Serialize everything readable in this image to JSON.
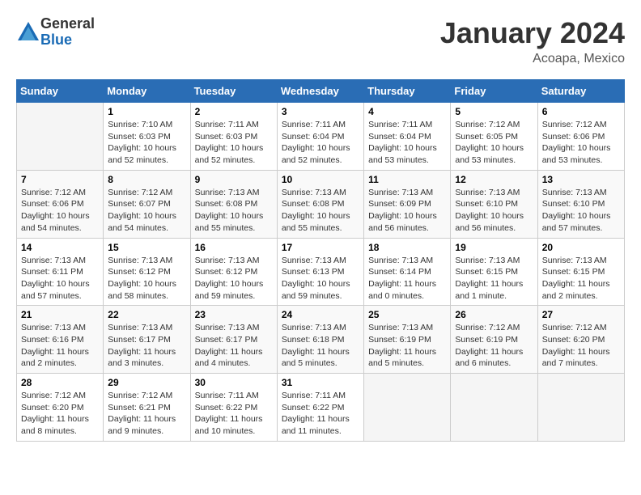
{
  "logo": {
    "general": "General",
    "blue": "Blue"
  },
  "header": {
    "title": "January 2024",
    "subtitle": "Acoapa, Mexico"
  },
  "days_of_week": [
    "Sunday",
    "Monday",
    "Tuesday",
    "Wednesday",
    "Thursday",
    "Friday",
    "Saturday"
  ],
  "weeks": [
    [
      {
        "num": "",
        "info": ""
      },
      {
        "num": "1",
        "info": "Sunrise: 7:10 AM\nSunset: 6:03 PM\nDaylight: 10 hours\nand 52 minutes."
      },
      {
        "num": "2",
        "info": "Sunrise: 7:11 AM\nSunset: 6:03 PM\nDaylight: 10 hours\nand 52 minutes."
      },
      {
        "num": "3",
        "info": "Sunrise: 7:11 AM\nSunset: 6:04 PM\nDaylight: 10 hours\nand 52 minutes."
      },
      {
        "num": "4",
        "info": "Sunrise: 7:11 AM\nSunset: 6:04 PM\nDaylight: 10 hours\nand 53 minutes."
      },
      {
        "num": "5",
        "info": "Sunrise: 7:12 AM\nSunset: 6:05 PM\nDaylight: 10 hours\nand 53 minutes."
      },
      {
        "num": "6",
        "info": "Sunrise: 7:12 AM\nSunset: 6:06 PM\nDaylight: 10 hours\nand 53 minutes."
      }
    ],
    [
      {
        "num": "7",
        "info": "Sunrise: 7:12 AM\nSunset: 6:06 PM\nDaylight: 10 hours\nand 54 minutes."
      },
      {
        "num": "8",
        "info": "Sunrise: 7:12 AM\nSunset: 6:07 PM\nDaylight: 10 hours\nand 54 minutes."
      },
      {
        "num": "9",
        "info": "Sunrise: 7:13 AM\nSunset: 6:08 PM\nDaylight: 10 hours\nand 55 minutes."
      },
      {
        "num": "10",
        "info": "Sunrise: 7:13 AM\nSunset: 6:08 PM\nDaylight: 10 hours\nand 55 minutes."
      },
      {
        "num": "11",
        "info": "Sunrise: 7:13 AM\nSunset: 6:09 PM\nDaylight: 10 hours\nand 56 minutes."
      },
      {
        "num": "12",
        "info": "Sunrise: 7:13 AM\nSunset: 6:10 PM\nDaylight: 10 hours\nand 56 minutes."
      },
      {
        "num": "13",
        "info": "Sunrise: 7:13 AM\nSunset: 6:10 PM\nDaylight: 10 hours\nand 57 minutes."
      }
    ],
    [
      {
        "num": "14",
        "info": "Sunrise: 7:13 AM\nSunset: 6:11 PM\nDaylight: 10 hours\nand 57 minutes."
      },
      {
        "num": "15",
        "info": "Sunrise: 7:13 AM\nSunset: 6:12 PM\nDaylight: 10 hours\nand 58 minutes."
      },
      {
        "num": "16",
        "info": "Sunrise: 7:13 AM\nSunset: 6:12 PM\nDaylight: 10 hours\nand 59 minutes."
      },
      {
        "num": "17",
        "info": "Sunrise: 7:13 AM\nSunset: 6:13 PM\nDaylight: 10 hours\nand 59 minutes."
      },
      {
        "num": "18",
        "info": "Sunrise: 7:13 AM\nSunset: 6:14 PM\nDaylight: 11 hours\nand 0 minutes."
      },
      {
        "num": "19",
        "info": "Sunrise: 7:13 AM\nSunset: 6:15 PM\nDaylight: 11 hours\nand 1 minute."
      },
      {
        "num": "20",
        "info": "Sunrise: 7:13 AM\nSunset: 6:15 PM\nDaylight: 11 hours\nand 2 minutes."
      }
    ],
    [
      {
        "num": "21",
        "info": "Sunrise: 7:13 AM\nSunset: 6:16 PM\nDaylight: 11 hours\nand 2 minutes."
      },
      {
        "num": "22",
        "info": "Sunrise: 7:13 AM\nSunset: 6:17 PM\nDaylight: 11 hours\nand 3 minutes."
      },
      {
        "num": "23",
        "info": "Sunrise: 7:13 AM\nSunset: 6:17 PM\nDaylight: 11 hours\nand 4 minutes."
      },
      {
        "num": "24",
        "info": "Sunrise: 7:13 AM\nSunset: 6:18 PM\nDaylight: 11 hours\nand 5 minutes."
      },
      {
        "num": "25",
        "info": "Sunrise: 7:13 AM\nSunset: 6:19 PM\nDaylight: 11 hours\nand 5 minutes."
      },
      {
        "num": "26",
        "info": "Sunrise: 7:12 AM\nSunset: 6:19 PM\nDaylight: 11 hours\nand 6 minutes."
      },
      {
        "num": "27",
        "info": "Sunrise: 7:12 AM\nSunset: 6:20 PM\nDaylight: 11 hours\nand 7 minutes."
      }
    ],
    [
      {
        "num": "28",
        "info": "Sunrise: 7:12 AM\nSunset: 6:20 PM\nDaylight: 11 hours\nand 8 minutes."
      },
      {
        "num": "29",
        "info": "Sunrise: 7:12 AM\nSunset: 6:21 PM\nDaylight: 11 hours\nand 9 minutes."
      },
      {
        "num": "30",
        "info": "Sunrise: 7:11 AM\nSunset: 6:22 PM\nDaylight: 11 hours\nand 10 minutes."
      },
      {
        "num": "31",
        "info": "Sunrise: 7:11 AM\nSunset: 6:22 PM\nDaylight: 11 hours\nand 11 minutes."
      },
      {
        "num": "",
        "info": ""
      },
      {
        "num": "",
        "info": ""
      },
      {
        "num": "",
        "info": ""
      }
    ]
  ]
}
